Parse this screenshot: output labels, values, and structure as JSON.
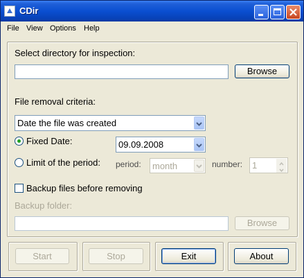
{
  "window": {
    "title": "CDir"
  },
  "menu": [
    "File",
    "View",
    "Options",
    "Help"
  ],
  "directory": {
    "label": "Select directory for inspection:",
    "value": "",
    "browse_label": "Browse"
  },
  "criteria": {
    "label": "File removal criteria:",
    "selected": "Date the file was created",
    "fixed_date": {
      "label": "Fixed Date:",
      "value": "09.09.2008",
      "checked": true
    },
    "limit_period": {
      "label": "Limit of the period:",
      "checked": false,
      "period_label": "period:",
      "period_value": "month",
      "number_label": "number:",
      "number_value": "1"
    }
  },
  "backup": {
    "checkbox_label": "Backup files before removing",
    "checked": false,
    "folder_label": "Backup folder:",
    "folder_value": "",
    "browse_label": "Browse"
  },
  "actions": {
    "start": "Start",
    "stop": "Stop",
    "exit": "Exit",
    "about": "About"
  }
}
